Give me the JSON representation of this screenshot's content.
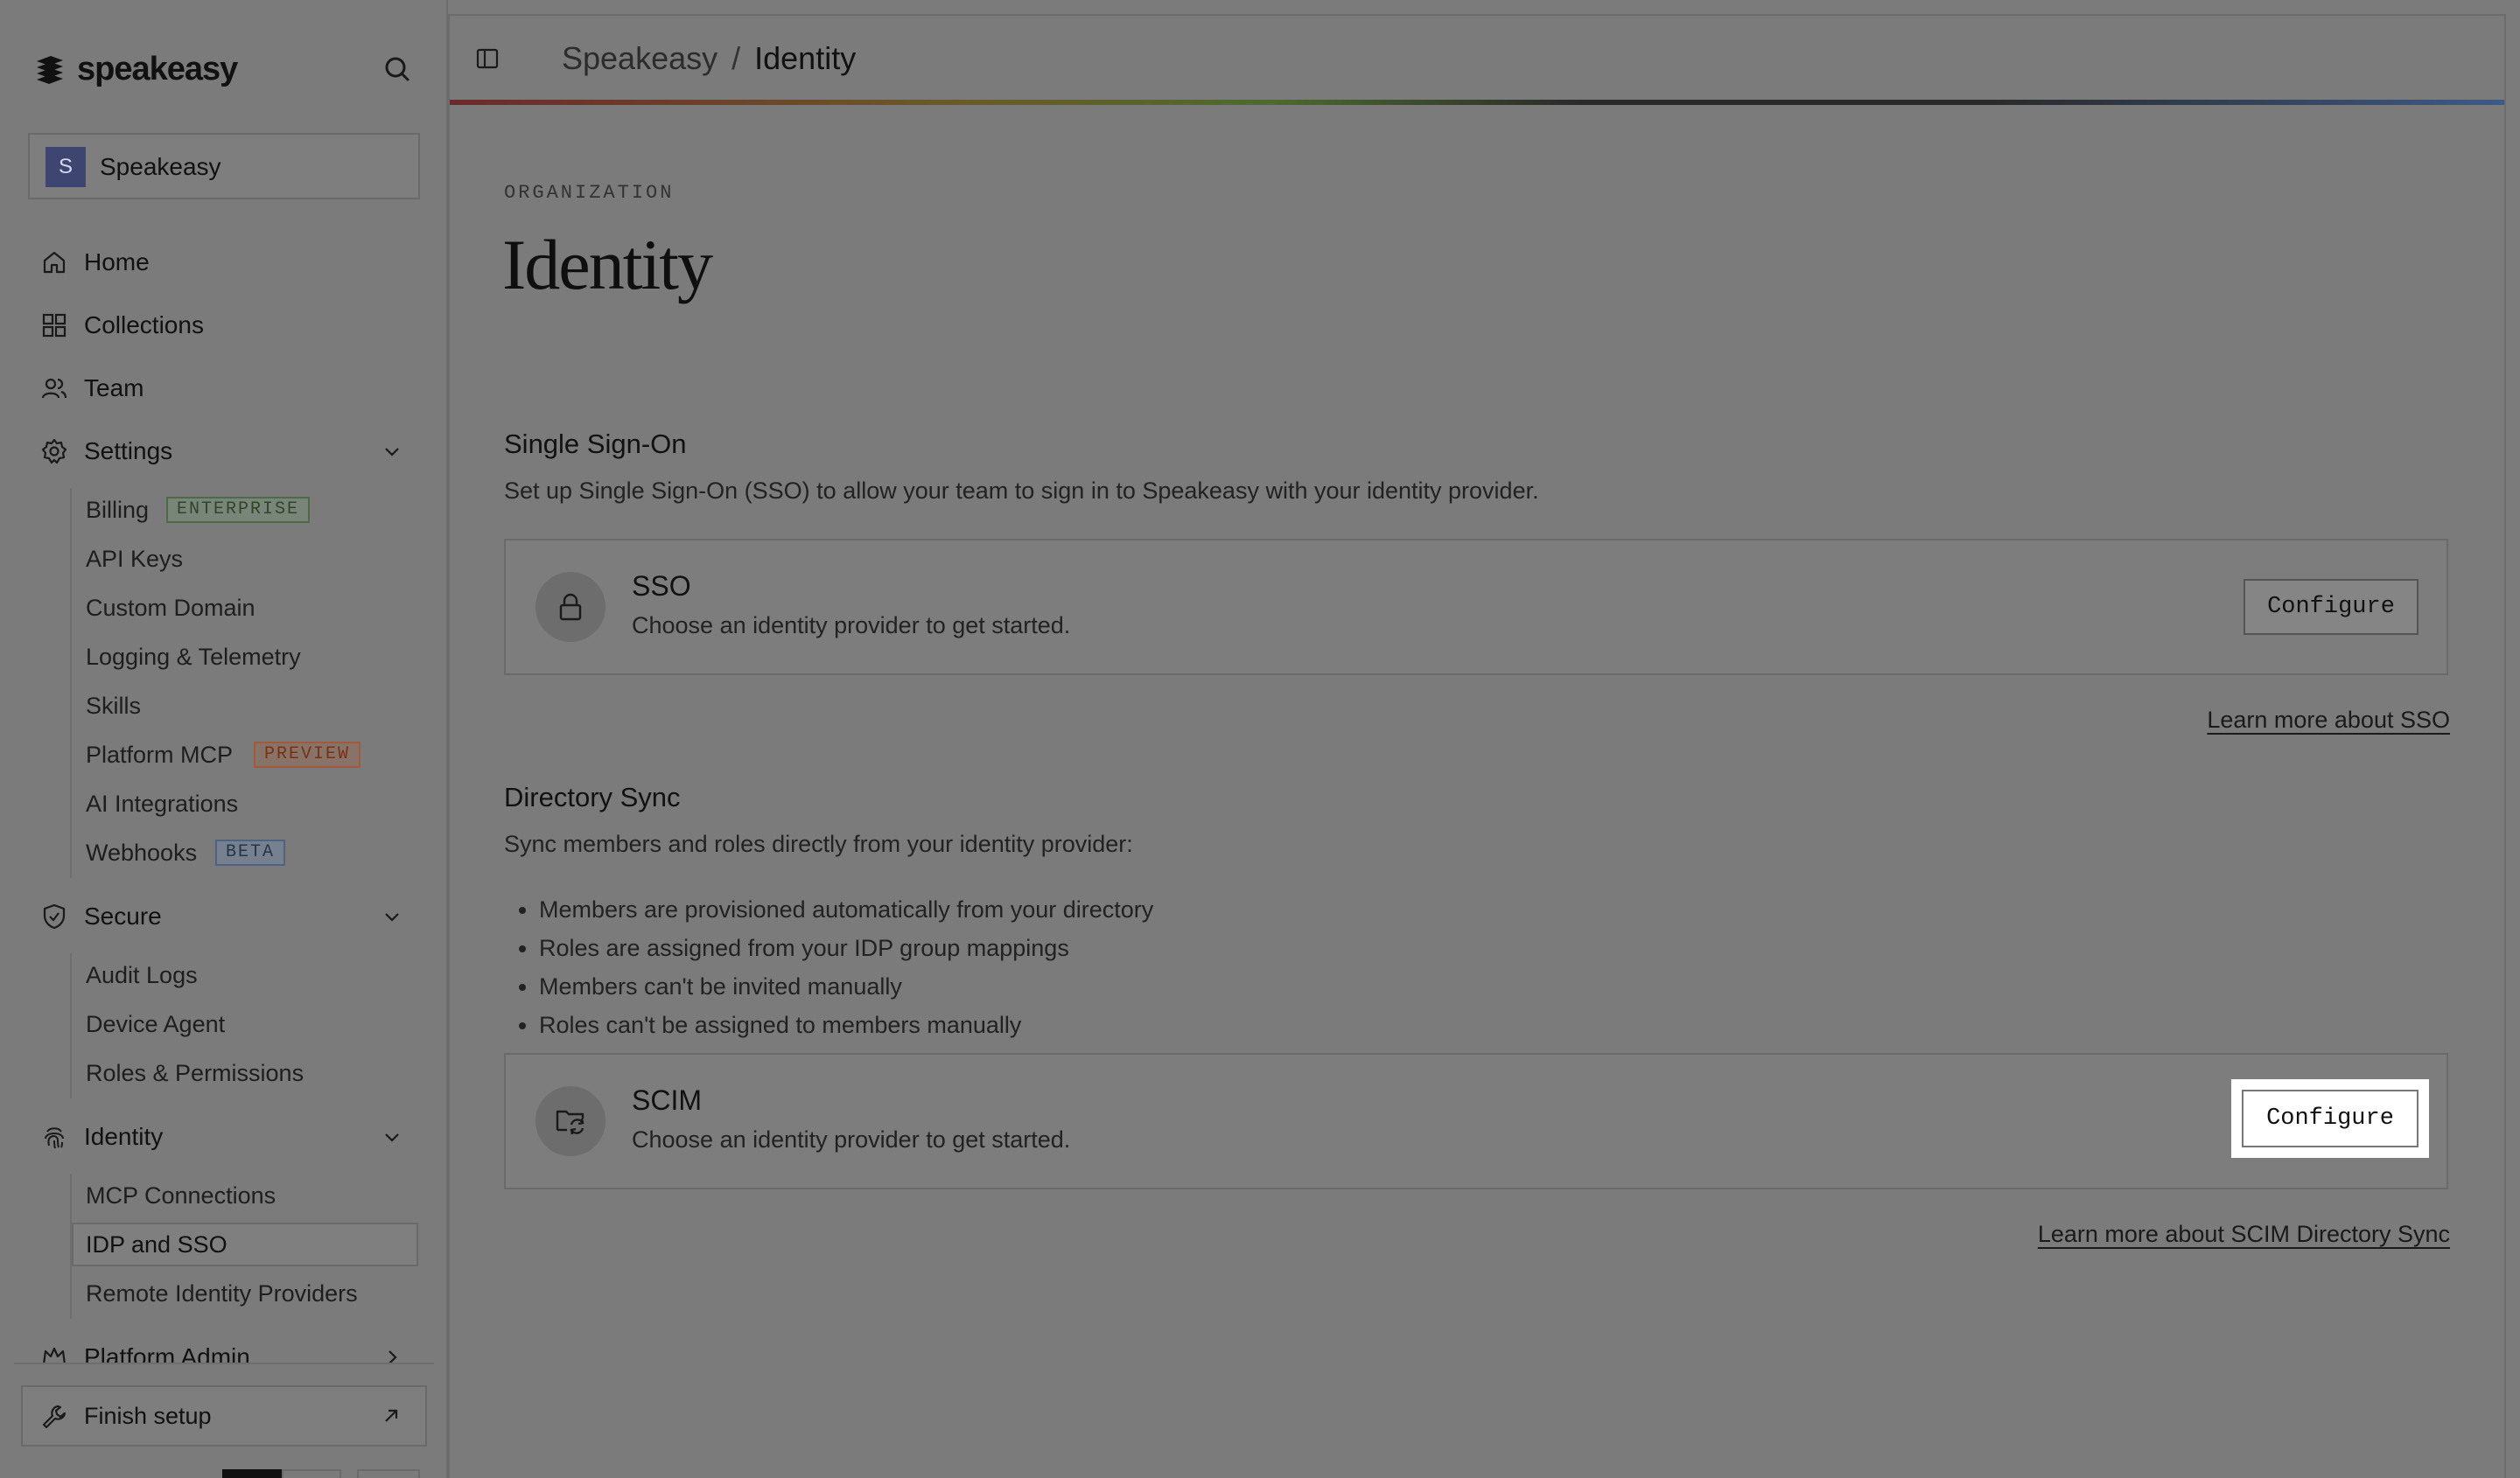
{
  "brand": {
    "name": "speakeasy"
  },
  "org": {
    "initial": "S",
    "name": "Speakeasy"
  },
  "nav": {
    "home": "Home",
    "collections": "Collections",
    "team": "Team",
    "settings": {
      "label": "Settings",
      "items": [
        {
          "label": "Billing",
          "badge": "ENTERPRISE"
        },
        {
          "label": "API Keys"
        },
        {
          "label": "Custom Domain"
        },
        {
          "label": "Logging & Telemetry"
        },
        {
          "label": "Skills"
        },
        {
          "label": "Platform MCP",
          "badge": "PREVIEW"
        },
        {
          "label": "AI Integrations"
        },
        {
          "label": "Webhooks",
          "badge": "BETA"
        }
      ]
    },
    "secure": {
      "label": "Secure",
      "items": [
        {
          "label": "Audit Logs"
        },
        {
          "label": "Device Agent"
        },
        {
          "label": "Roles & Permissions"
        }
      ]
    },
    "identity": {
      "label": "Identity",
      "items": [
        {
          "label": "MCP Connections"
        },
        {
          "label": "IDP and SSO",
          "active": true
        },
        {
          "label": "Remote Identity Providers"
        }
      ]
    },
    "platform_admin": "Platform Admin",
    "finish_setup": "Finish setup"
  },
  "breadcrumb": {
    "parent": "Speakeasy",
    "separator": "/",
    "current": "Identity"
  },
  "page": {
    "eyebrow": "ORGANIZATION",
    "title": "Identity"
  },
  "sso_section": {
    "title": "Single Sign-On",
    "description": "Set up Single Sign-On (SSO) to allow your team to sign in to Speakeasy with your identity provider.",
    "card": {
      "title": "SSO",
      "description": "Choose an identity provider to get started.",
      "button": "Configure",
      "icon": "lock-icon"
    },
    "learn_more": "Learn more about SSO"
  },
  "directory_section": {
    "title": "Directory Sync",
    "description": "Sync members and roles directly from your identity provider:",
    "bullets": [
      "Members are provisioned automatically from your directory",
      "Roles are assigned from your IDP group mappings",
      "Members can't be invited manually",
      "Roles can't be assigned to members manually"
    ],
    "card": {
      "title": "SCIM",
      "description": "Choose an identity provider to get started.",
      "button": "Configure",
      "icon": "folder-sync-icon"
    },
    "learn_more": "Learn more about SCIM Directory Sync"
  },
  "colors": {
    "overlay": "#7b7b7b",
    "highlight": "#ffffff",
    "initial_avatar": "#3d4570"
  }
}
